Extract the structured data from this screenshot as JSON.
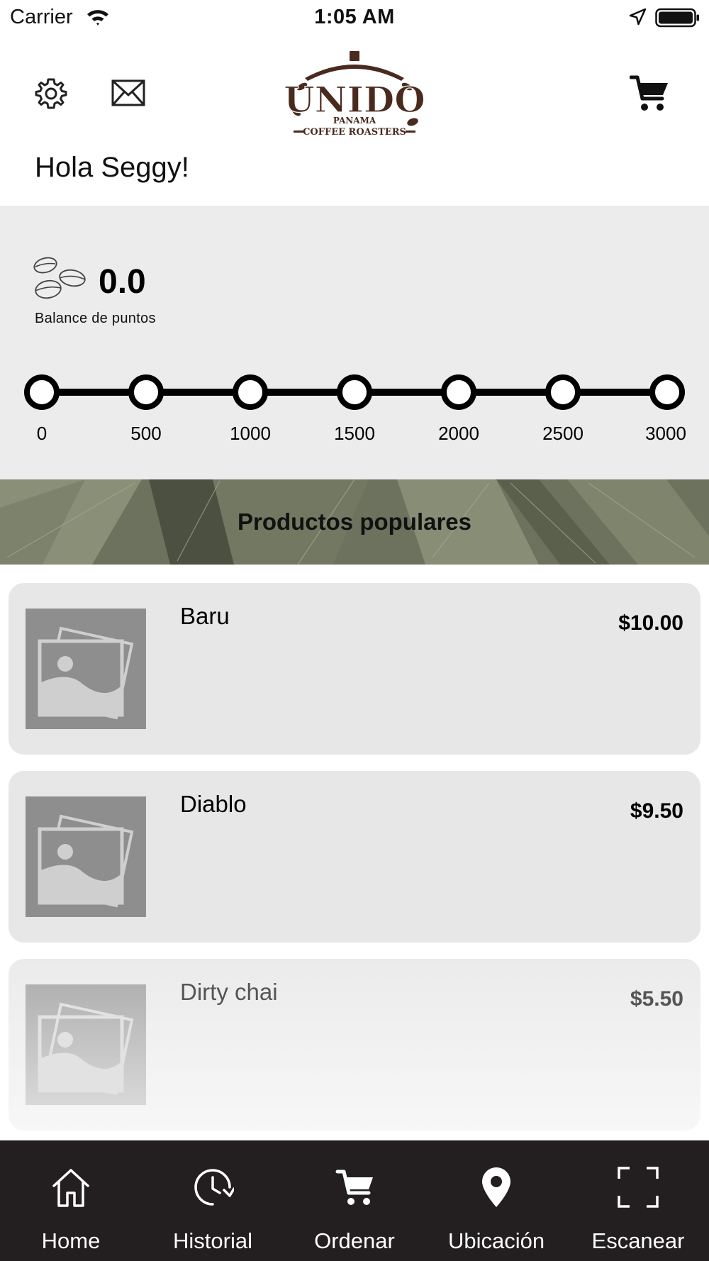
{
  "status_bar": {
    "carrier": "Carrier",
    "time": "1:05 AM"
  },
  "header": {
    "logo": {
      "brand": "UNIDO",
      "country": "PANAMA",
      "tagline": "COFFEE ROASTERS"
    },
    "icons": [
      "gear-icon",
      "mail-icon",
      "cart-icon"
    ]
  },
  "greeting": "Hola Seggy!",
  "points": {
    "value": "0.0",
    "label": "Balance de puntos",
    "milestones": [
      "0",
      "500",
      "1000",
      "1500",
      "2000",
      "2500",
      "3000"
    ],
    "progress_fraction": 0
  },
  "banner": {
    "title": "Productos populares"
  },
  "products": [
    {
      "name": "Baru",
      "price": "$10.00"
    },
    {
      "name": "Diablo",
      "price": "$9.50"
    },
    {
      "name": "Dirty chai",
      "price": "$5.50"
    }
  ],
  "tab_bar": {
    "tabs": [
      {
        "label": "Home",
        "icon": "home-icon"
      },
      {
        "label": "Historial",
        "icon": "history-icon"
      },
      {
        "label": "Ordenar",
        "icon": "cart-icon"
      },
      {
        "label": "Ubicación",
        "icon": "location-pin-icon"
      },
      {
        "label": "Escanear",
        "icon": "scan-icon"
      }
    ]
  },
  "colors": {
    "panel": "#ececec",
    "card": "#e7e7e7",
    "tab_bar": "#231f20",
    "logo_brown": "#4a2a1e",
    "banner_green": "#6f7461"
  }
}
